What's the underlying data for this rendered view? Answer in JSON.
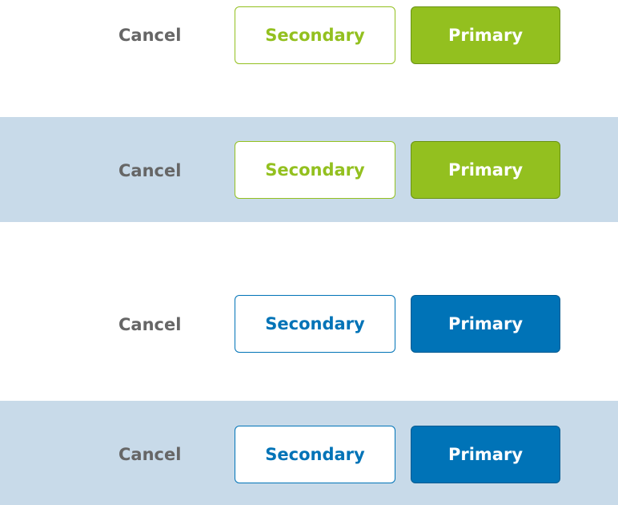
{
  "groups": [
    {
      "theme": "green",
      "accent": "#93c01f",
      "accent_border": "#6a9214",
      "band": false,
      "cancel_label": "Cancel",
      "secondary_label": "Secondary",
      "primary_label": "Primary"
    },
    {
      "theme": "green",
      "accent": "#93c01f",
      "accent_border": "#6a9214",
      "band": true,
      "cancel_label": "Cancel",
      "secondary_label": "Secondary",
      "primary_label": "Primary"
    },
    {
      "theme": "blue",
      "accent": "#0073b7",
      "accent_border": "#005a91",
      "band": false,
      "cancel_label": "Cancel",
      "secondary_label": "Secondary",
      "primary_label": "Primary"
    },
    {
      "theme": "blue",
      "accent": "#0073b7",
      "accent_border": "#005a91",
      "band": true,
      "cancel_label": "Cancel",
      "secondary_label": "Secondary",
      "primary_label": "Primary"
    }
  ],
  "colors": {
    "cancel_text": "#666666",
    "band_background": "#c8dae9",
    "page_background": "#ffffff"
  }
}
